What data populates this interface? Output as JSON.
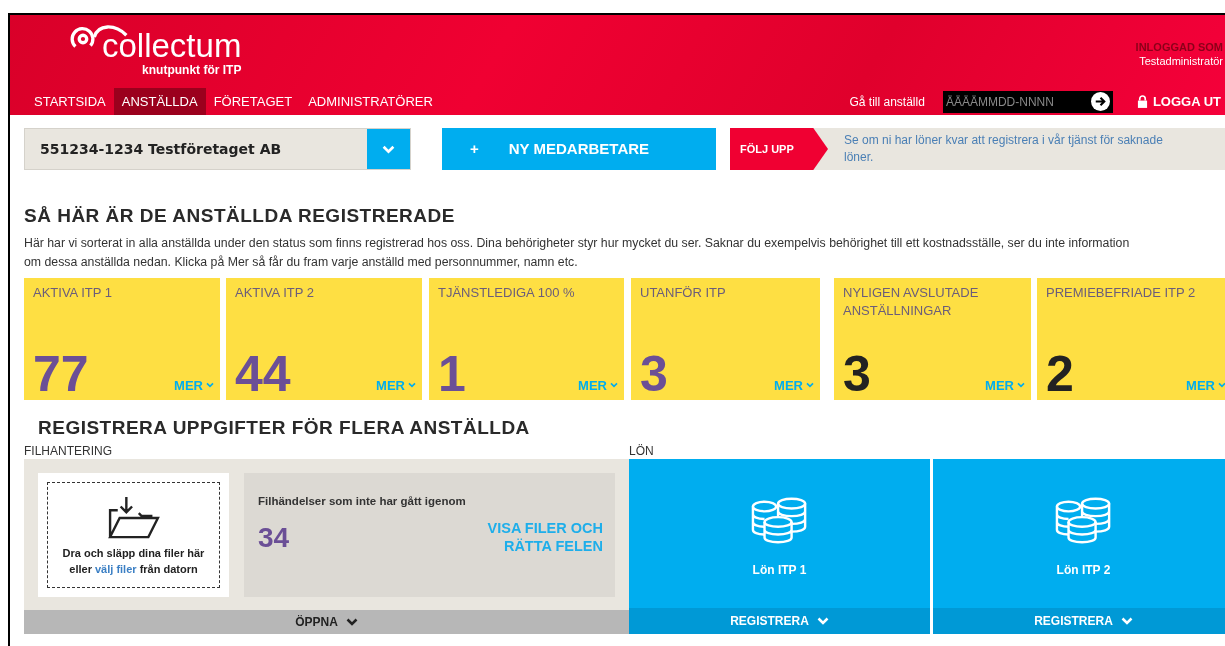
{
  "header": {
    "logo": "collectum",
    "tagline": "knutpunkt för ITP",
    "logged_in_label": "INLOGGAD SOM",
    "user": "Testadministratör",
    "goto_label": "Gå till anställd",
    "goto_placeholder": "ÅÅÅÅMMDD-NNNN",
    "logout": "LOGGA UT"
  },
  "nav": [
    {
      "label": "STARTSIDA",
      "selected": false
    },
    {
      "label": "ANSTÄLLDA",
      "selected": true
    },
    {
      "label": "FÖRETAGET",
      "selected": false
    },
    {
      "label": "ADMINISTRATÖRER",
      "selected": false
    }
  ],
  "company_select": "551234-1234 Testföretaget AB",
  "new_employee": {
    "icon": "+",
    "label": "NY MEDARBETARE"
  },
  "follow_up": {
    "label": "FÖLJ UPP",
    "text": "Se om ni har löner kvar att registrera i vår tjänst för saknade löner."
  },
  "status": {
    "title": "SÅ HÄR ÄR DE ANSTÄLLDA REGISTRERADE",
    "description": "Här har vi sorterat in alla anställda under den status som finns registrerad hos oss. Dina behörigheter styr hur mycket du ser. Saknar du exempelvis behörighet till ett kostnadsställe, ser du inte information om dessa anställda nedan. Klicka på Mer så får du fram varje anställd med personnummer, namn etc.",
    "tiles": [
      {
        "label": "AKTIVA ITP 1",
        "count": "77",
        "color": "#6b4f96",
        "more": "MER"
      },
      {
        "label": "AKTIVA ITP 2",
        "count": "44",
        "color": "#6b4f96",
        "more": "MER"
      },
      {
        "label": "TJÄNSTLEDIGA 100 %",
        "count": "1",
        "color": "#6b4f96",
        "more": "MER"
      },
      {
        "label": "UTANFÖR ITP",
        "count": "3",
        "color": "#6b4f96",
        "more": "MER"
      },
      {
        "label": "NYLIGEN AVSLUTADE ANSTÄLLNINGAR",
        "count": "3",
        "color": "#222222",
        "more": "MER"
      },
      {
        "label": "PREMIEBEFRIADE ITP 2",
        "count": "2",
        "color": "#222222",
        "more": "MER"
      }
    ]
  },
  "bulk": {
    "title": "REGISTRERA UPPGIFTER FÖR FLERA ANSTÄLLDA",
    "files": {
      "label": "FILHANTERING",
      "drop_text_1": "Dra och släpp dina filer här",
      "drop_text_2_before": "eller",
      "drop_link": "välj filer",
      "drop_text_2_after": "från datorn",
      "events_label": "Filhändelser som inte har gått igenom",
      "events_count": "34",
      "events_link": "VISA FILER OCH RÄTTA FELEN",
      "open": "ÖPPNA"
    },
    "salary": {
      "label": "LÖN",
      "cards": [
        {
          "title": "Lön ITP 1",
          "action": "REGISTRERA"
        },
        {
          "title": "Lön ITP 2",
          "action": "REGISTRERA"
        }
      ]
    }
  }
}
